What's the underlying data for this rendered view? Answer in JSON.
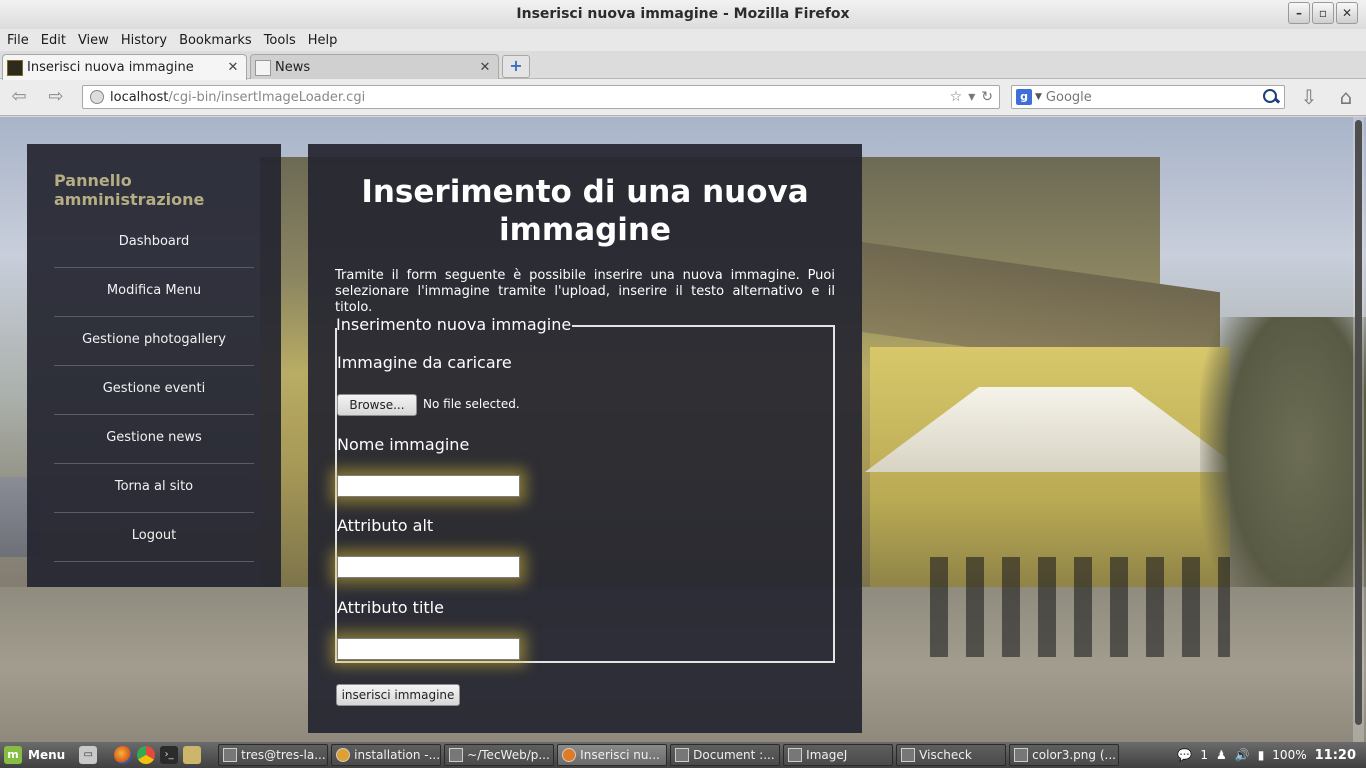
{
  "window": {
    "title": "Inserisci nuova immagine - Mozilla Firefox"
  },
  "menubar": [
    "File",
    "Edit",
    "View",
    "History",
    "Bookmarks",
    "Tools",
    "Help"
  ],
  "tabs": [
    {
      "label": "Inserisci nuova immagine",
      "active": true
    },
    {
      "label": "News",
      "active": false
    }
  ],
  "navbar": {
    "url_host": "localhost",
    "url_path": "/cgi-bin/insertImageLoader.cgi",
    "search_placeholder": "Google"
  },
  "sidebar": {
    "title": "Pannello amministrazione",
    "items": [
      "Dashboard",
      "Modifica Menu",
      "Gestione photogallery",
      "Gestione eventi",
      "Gestione news",
      "Torna al sito",
      "Logout"
    ]
  },
  "main": {
    "heading": "Inserimento di una nuova immagine",
    "intro": "Tramite il form seguente è possibile inserire una nuova immagine. Puoi selezionare l'immagine tramite l'upload, inserire il testo alternativo e il titolo.",
    "legend": "Inserimento nuova immagine",
    "upload_label": "Immagine da caricare",
    "browse_label": "Browse...",
    "no_file": "No file selected.",
    "name_label": "Nome immagine",
    "name_value": "",
    "alt_label": "Attributo alt",
    "alt_value": "",
    "title_label": "Attributo title",
    "title_value": "",
    "submit_label": "inserisci immagine"
  },
  "taskbar": {
    "menu_label": "Menu",
    "tasks": [
      "tres@tres-la...",
      "installation -...",
      "~/TecWeb/p...",
      "Inserisci nu...",
      "Document :...",
      "ImageJ",
      "Vischeck",
      "color3.png (..."
    ],
    "tray_count": "1",
    "battery": "100%",
    "clock": "11:20"
  },
  "colors": {
    "panel_bg": "#25263",
    "sidebar_title": "#b5ad84",
    "input_glow": "#ceb438"
  }
}
